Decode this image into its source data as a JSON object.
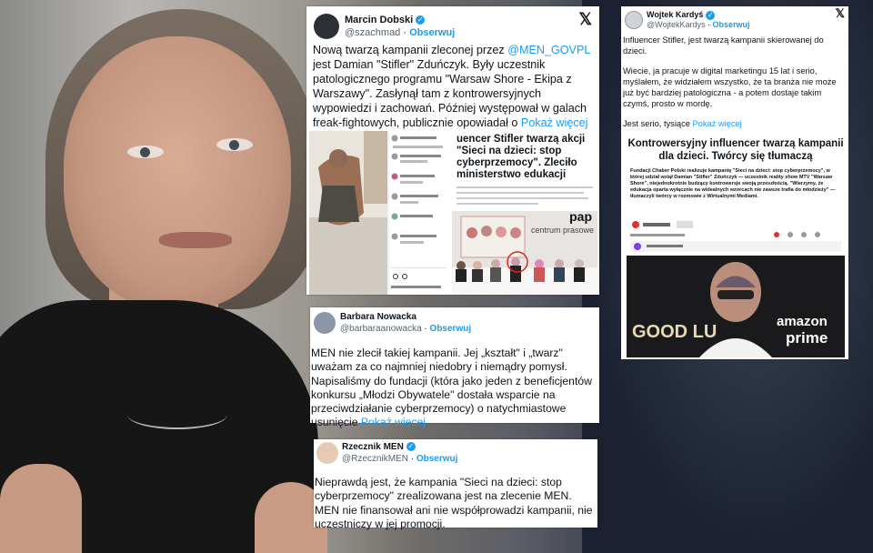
{
  "tweets": {
    "dobski": {
      "name": "Marcin Dobski",
      "handle": "@szachmad",
      "follow": "Obserwuj",
      "text_1": "Nową twarzą kampanii zleconej przez ",
      "mention": "@MEN_GOVPL",
      "text_2": " jest Damian \"Stifler\" Zduńczyk. Były uczestnik patologicznego programu \"Warsaw Shore - Ekipa z Warszawy\". Zasłynął tam z kontrowersyjnych wypowiedzi i zachowań. Później występował w galach freak-fightowych, publicznie opowiadał o ",
      "more": "Pokaż więcej",
      "media_headline": "uencer Stifler twarzą akcji \"Sieci na dzieci: stop cyberprzemocy\". Zleciło ministerstwo edukacji",
      "media_caption": "centrum prasowe",
      "media_logo": "pap"
    },
    "kardys": {
      "name": "Wojtek Kardyś",
      "handle": "@WojtekKardys",
      "follow": "Obserwuj",
      "p1": "Influencer Stifler, jest twarzą kampanii skierowanej do dzieci.",
      "p2": "Wiecie, ja pracuje w digital marketingu 15 lat i serio, myślałem, że widziałem wszystko, że ta branża nie może już być bardziej patologiczna - a potem dostaje takim czymś, prosto w mordę.",
      "p3_text": "Jest serio, tysiące ",
      "more": "Pokaż więcej",
      "article_title": "Kontrowersyjny influencer twarzą kampanii dla dzieci. Twórcy się tłumaczą",
      "article_lead": "Fundacji Chaber Polski realizuje kampanię \"Sieci na dzieci: stop cyberprzemocy\", w której udział wziął Damian \"Stifler\" Zduńczyk — uczestnik reality show MTV \"Warsaw Shore\", niejednokrotnie budzący kontrowersje swoją przeszłością. \"Wierzymy, że edukacja oparta wyłącznie na widealnych wzorcach nie zawsze trafia do młodzieży\" — tłumaczyli twórcy w rozmowie z Wirtualnymi Mediami.",
      "photo_text_1": "GOOD LU",
      "photo_text_2": "amazon",
      "photo_text_3": "prime"
    },
    "nowacka": {
      "name": "Barbara Nowacka",
      "handle": "@barbaraanowacka",
      "follow": "Obserwuj",
      "text": "MEN nie zlecił takiej kampanii. Jej „kształt\" i „twarz\" uważam za co najmniej niedobry i niemądry pomysł. Napisaliśmy do fundacji (która  jako jeden z beneficjentów konkursu „Młodzi Obywatele\" dostała wsparcie na przeciwdziałanie cyberprzemocy) o natychmiastowe usunięcie ",
      "more": "Pokaż więcej"
    },
    "rzecznik": {
      "name": "Rzecznik MEN",
      "handle": "@RzecznikMEN",
      "follow": "Obserwuj",
      "text": "Nieprawdą jest, że kampania \"Sieci na dzieci: stop cyberprzemocy\" zrealizowana jest na zlecenie MEN. MEN nie finansował ani nie współprowadzi kampanii, nie uczestniczy w jej promocji."
    }
  },
  "icons": {
    "x_logo": "𝕏",
    "verified": "✓"
  },
  "colors": {
    "link": "#1d9bf0",
    "text": "#0f1419",
    "handle": "#536471"
  }
}
